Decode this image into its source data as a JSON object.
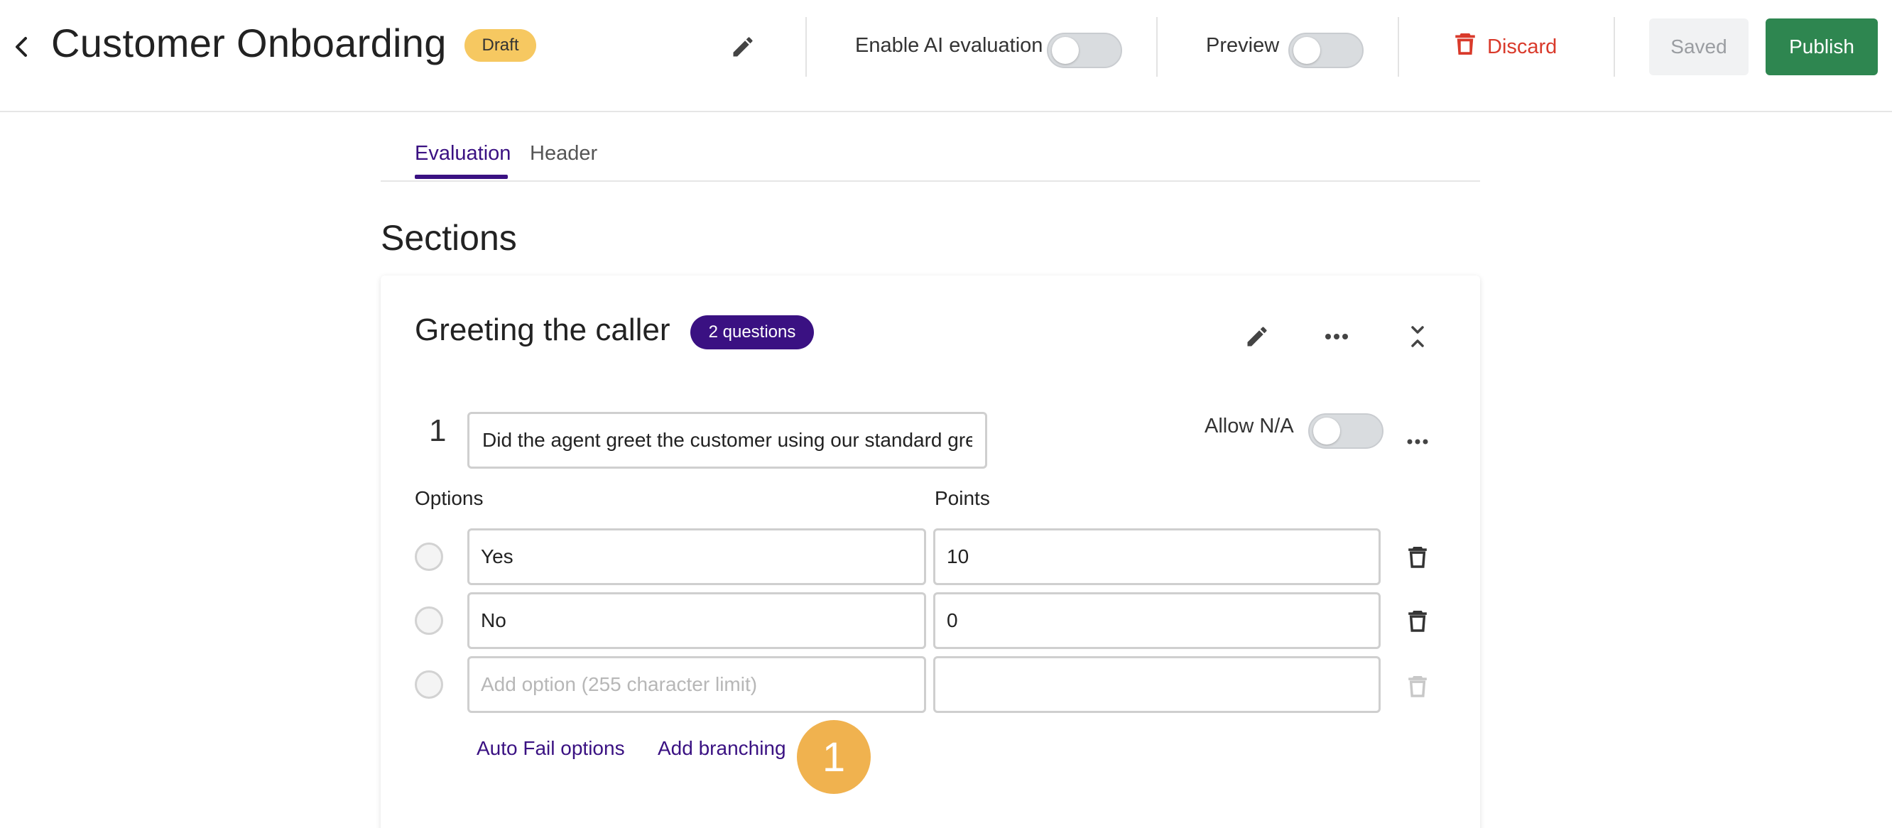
{
  "header": {
    "title": "Customer Onboarding",
    "status_badge": "Draft",
    "ai_eval_label": "Enable AI evaluation",
    "preview_label": "Preview",
    "discard_label": "Discard",
    "saved_label": "Saved",
    "publish_label": "Publish"
  },
  "tabs": [
    {
      "label": "Evaluation",
      "active": true
    },
    {
      "label": "Header",
      "active": false
    }
  ],
  "sections_title": "Sections",
  "section": {
    "title": "Greeting the caller",
    "question_count": "2 questions",
    "question": {
      "number": "1",
      "text": "Did the agent greet the customer using our standard greeting message?",
      "allow_na_label": "Allow N/A",
      "options_header": "Options",
      "points_header": "Points",
      "options": [
        {
          "label": "Yes",
          "points": "10"
        },
        {
          "label": "No",
          "points": "0"
        }
      ],
      "new_option_placeholder": "Add option (255 character limit)",
      "auto_fail_label": "Auto Fail options",
      "add_branching_label": "Add branching"
    }
  },
  "step_marker": "1",
  "colors": {
    "accent": "#3a1182",
    "publish": "#2e8650",
    "discard": "#d93a2b",
    "draft": "#f6c861",
    "marker": "#f0b24f"
  },
  "icons": [
    "chevron-left-icon",
    "pencil-icon",
    "trash-icon",
    "more-horizontal-icon",
    "collapse-icon"
  ]
}
